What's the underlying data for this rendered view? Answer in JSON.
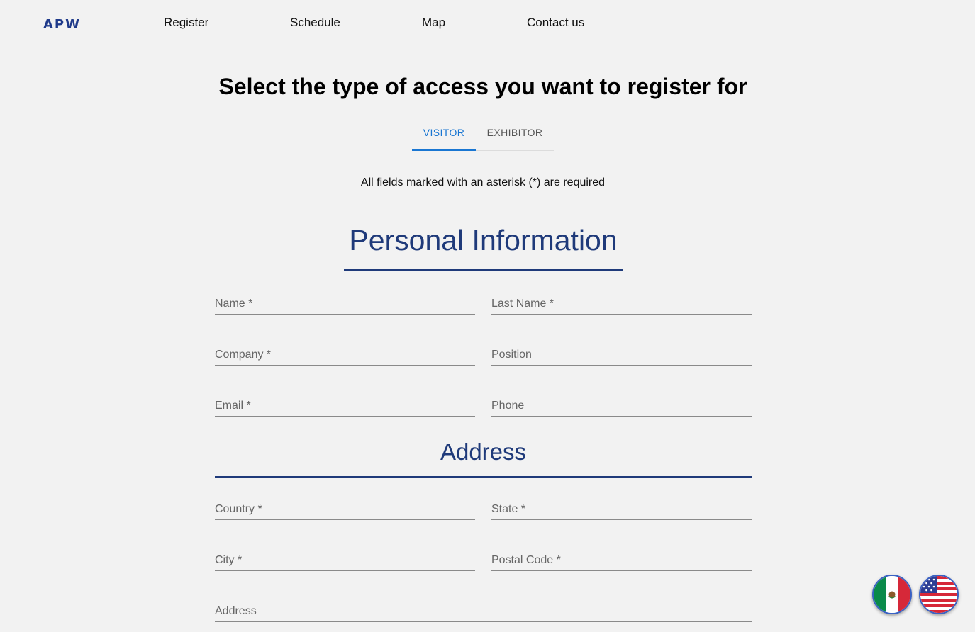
{
  "header": {
    "logo": "APW",
    "nav": [
      "Register",
      "Schedule",
      "Map",
      "Contact us"
    ]
  },
  "main": {
    "title": "Select the type of access you want to register for",
    "tabs": [
      {
        "label": "VISITOR",
        "active": true
      },
      {
        "label": "EXHIBITOR",
        "active": false
      }
    ],
    "required_note": "All fields marked with an asterisk (*) are required"
  },
  "personal": {
    "title": "Personal Information",
    "fields": {
      "name": "Name *",
      "last_name": "Last Name *",
      "company": "Company *",
      "position": "Position",
      "email": "Email *",
      "phone": "Phone"
    }
  },
  "address": {
    "title": "Address",
    "fields": {
      "country": "Country *",
      "state": "State *",
      "city": "City *",
      "postal_code": "Postal Code *",
      "address": "Address"
    }
  },
  "language": {
    "options": [
      "mexico-flag-icon",
      "usa-flag-icon"
    ]
  },
  "colors": {
    "brand": "#1f3a7a",
    "tab_active": "#1976d2",
    "background": "#f2f2f2"
  }
}
